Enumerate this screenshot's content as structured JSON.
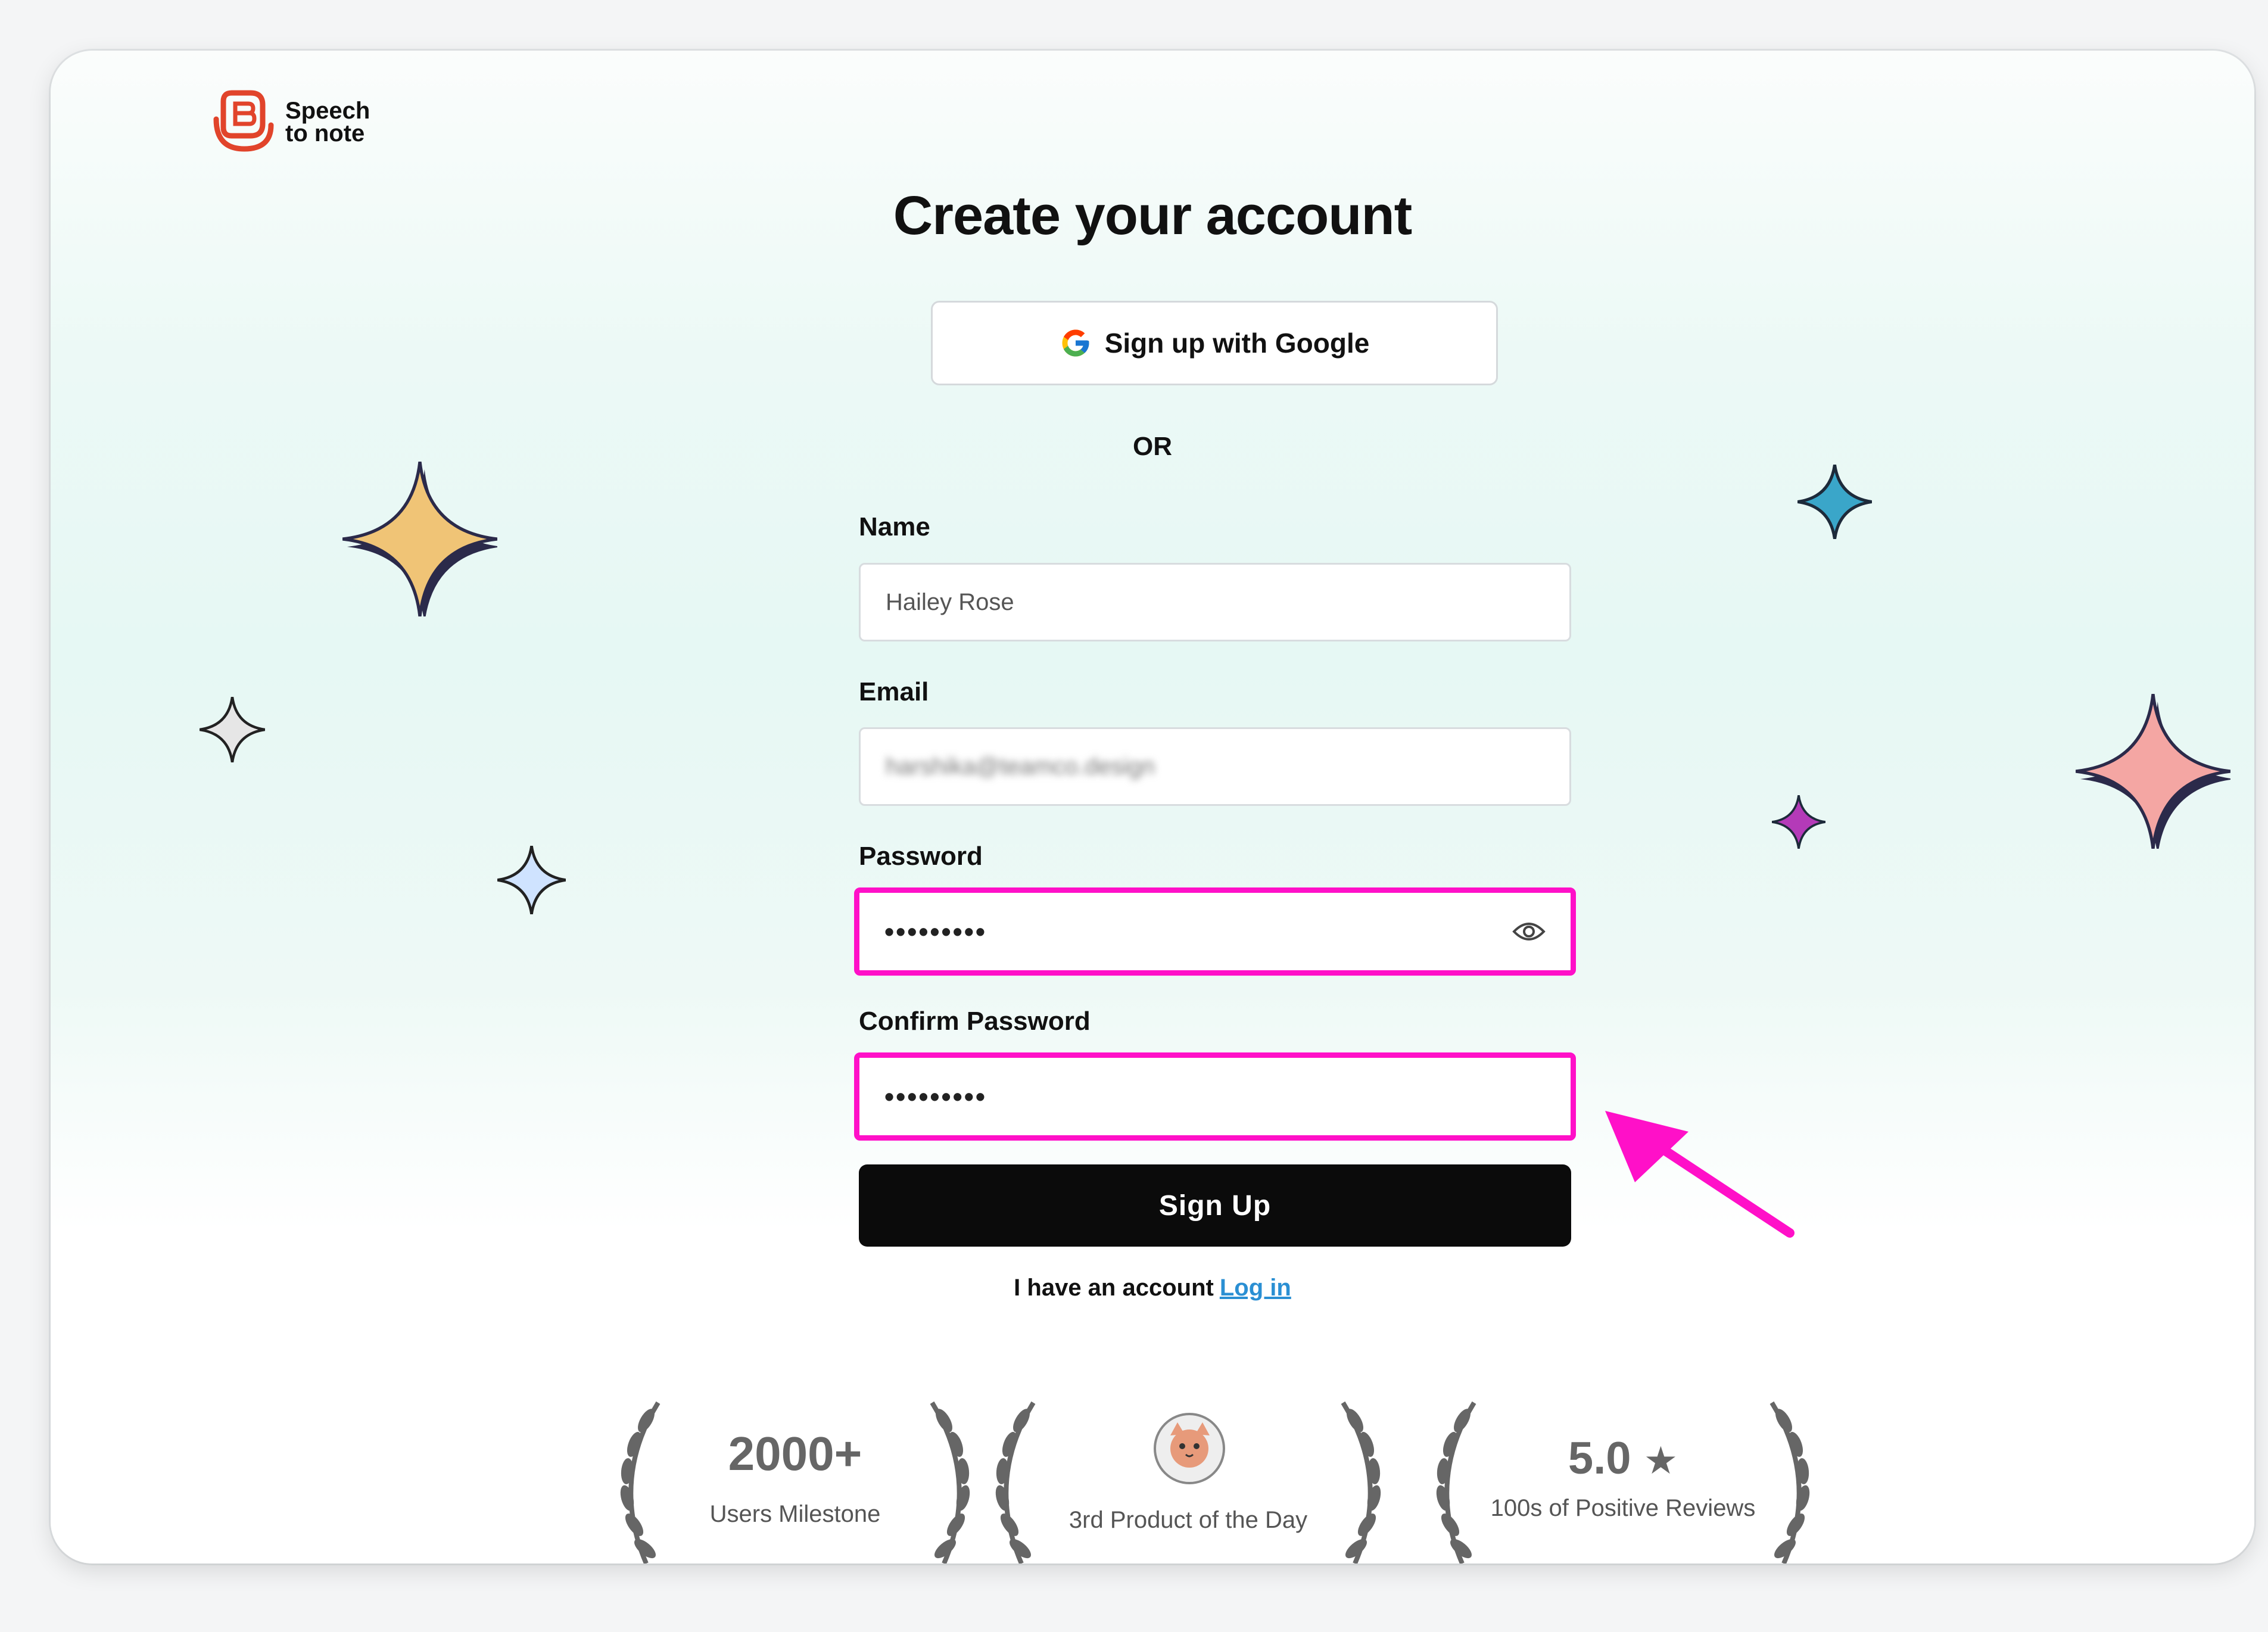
{
  "app": {
    "logo_line1": "Speech",
    "logo_line2": "to note",
    "brand_color": "#e1442b"
  },
  "form": {
    "title": "Create your account",
    "google_button": "Sign up with Google",
    "divider": "OR",
    "name_label": "Name",
    "name_value": "Hailey Rose",
    "email_label": "Email",
    "email_value": "harshika@teamco.design",
    "password_label": "Password",
    "password_value": "•••••••••",
    "confirm_label": "Confirm Password",
    "confirm_value": "•••••••••",
    "submit": "Sign Up",
    "have_account": "I have an account",
    "login_link": "Log in"
  },
  "badges": [
    {
      "main": "2000+",
      "sub": "Users Milestone"
    },
    {
      "main": "",
      "sub": "3rd Product of the Day"
    },
    {
      "main": "5.0",
      "sub": "100s of Positive Reviews"
    }
  ],
  "colors": {
    "highlight": "#ff10c8",
    "link": "#2a8fd3",
    "button_bg": "#0b0b0b"
  },
  "icons": {
    "google": "google-g-icon",
    "eye": "eye-icon",
    "star": "star-icon"
  }
}
